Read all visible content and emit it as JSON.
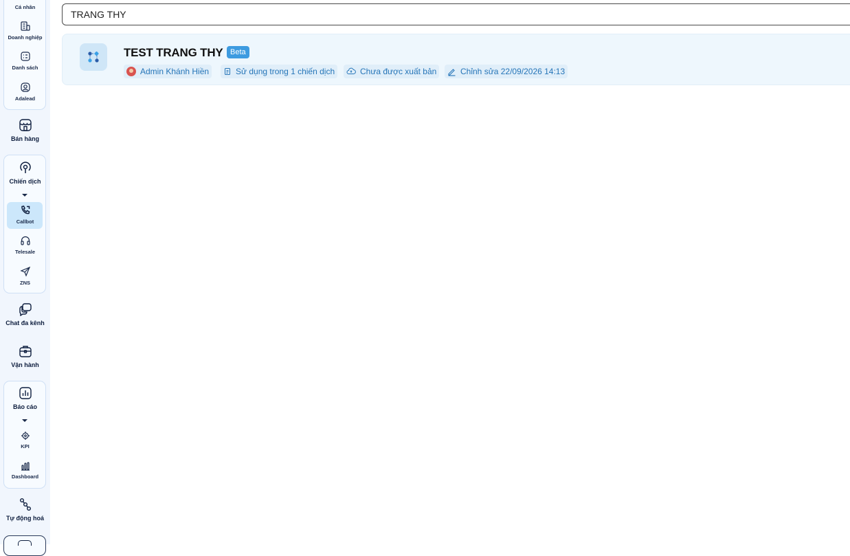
{
  "sidebar": {
    "ca_nhan": "Cá nhân",
    "doanh_nghiep": "Doanh nghiệp",
    "danh_sach": "Danh sách",
    "adalead": "Adalead",
    "ban_hang": "Bán hàng",
    "chien_dich": "Chiến dịch",
    "callbot": "Callbot",
    "telesale": "Telesale",
    "zns": "ZNS",
    "chat_da_kenh": "Chat đa kênh",
    "van_hanh": "Vận hành",
    "bao_cao": "Báo cáo",
    "kpi": "KPI",
    "dashboard": "Dashboard",
    "tu_dong_hoa": "Tự động hoá"
  },
  "search": {
    "value": "TRANG THY"
  },
  "card": {
    "title": "TEST TRANG THY",
    "badge": "Beta",
    "author": "Admin Khánh Hiền",
    "usage": "Sử dụng trong 1 chiến dịch",
    "status": "Chưa được xuất bản",
    "edited": "Chỉnh sửa 22/09/2026 14:13"
  },
  "colors": {
    "accent": "#2575b8",
    "active_bg": "#cce7fb",
    "card_bg": "#eef7fd",
    "badge": "#3d9be0"
  }
}
